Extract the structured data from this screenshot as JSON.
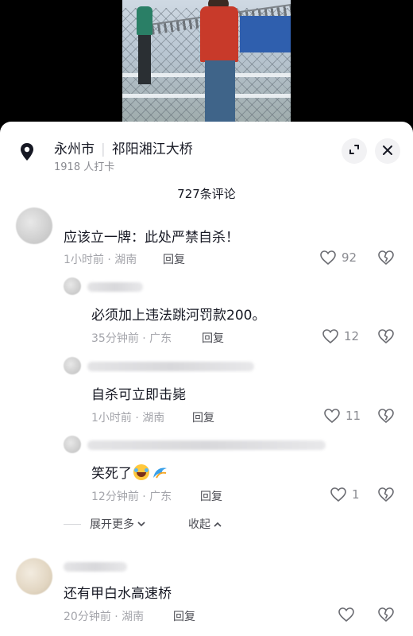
{
  "location": {
    "city": "永州市",
    "place": "祁阳湘江大桥",
    "checkins": "1918 人打卡"
  },
  "comments_header": {
    "count_label": "727条评论"
  },
  "comments": [
    {
      "text": "应该立一牌：此处严禁自杀！",
      "time_region": "1小时前 · 湖南",
      "reply_label": "回复",
      "likes": "92",
      "replies": [
        {
          "text": "必须加上违法跳河罚款200。",
          "time_region": "35分钟前 · 广东",
          "reply_label": "回复",
          "likes": "12"
        },
        {
          "text": "自杀可立即击毙",
          "time_region": "1小时前 · 湖南",
          "reply_label": "回复",
          "likes": "11"
        },
        {
          "text": "笑死了",
          "time_region": "12分钟前 · 广东",
          "reply_label": "回复",
          "likes": "1"
        }
      ]
    },
    {
      "text": "还有甲白水高速桥",
      "time_region": "20分钟前 · 湖南",
      "reply_label": "回复",
      "likes": ""
    }
  ],
  "thread_controls": {
    "expand_more": "展开更多",
    "collapse": "收起"
  },
  "icons": {
    "location": "location-pin-icon",
    "expand": "expand-icon",
    "close": "close-icon",
    "like": "heart-outline-icon",
    "dislike": "broken-heart-icon",
    "chevron_down": "chevron-down-icon",
    "chevron_up": "chevron-up-icon",
    "laugh_emoji": "laughing-tears-emoji",
    "wave_emoji": "wave-emoji"
  },
  "colors": {
    "text_primary": "#161823",
    "text_secondary": "#a4a5ab",
    "sheet_bg": "#ffffff"
  }
}
